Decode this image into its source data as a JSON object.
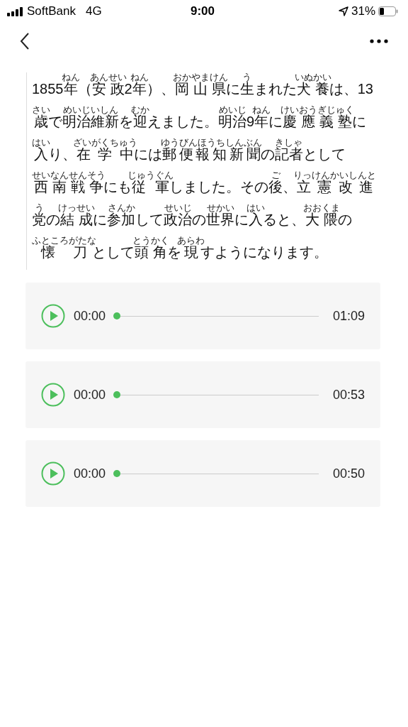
{
  "status_bar": {
    "carrier": "SoftBank",
    "network": "4G",
    "time": "9:00",
    "battery": "31%"
  },
  "paragraph": [
    {
      "t": "1855"
    },
    {
      "t": "年",
      "r": "ねん"
    },
    {
      "t": "（"
    },
    {
      "t": "安政",
      "r": "あんせい"
    },
    {
      "t": "2"
    },
    {
      "t": "年",
      "r": "ねん"
    },
    {
      "t": "）、"
    },
    {
      "t": "岡山県",
      "r": "おかやまけん"
    },
    {
      "t": "に"
    },
    {
      "t": "生",
      "r": "う"
    },
    {
      "t": "まれた"
    },
    {
      "t": "犬養",
      "r": "いぬかい"
    },
    {
      "t": "は、13"
    },
    {
      "t": "歳",
      "r": "さい"
    },
    {
      "t": "で"
    },
    {
      "t": "明治維新",
      "r": "めいじいしん"
    },
    {
      "t": "を"
    },
    {
      "t": "迎",
      "r": "むか"
    },
    {
      "t": "えました。"
    },
    {
      "t": "明治",
      "r": "めいじ"
    },
    {
      "t": "9"
    },
    {
      "t": "年",
      "r": "ねん"
    },
    {
      "t": "に"
    },
    {
      "t": "慶應義塾",
      "r": "けいおうぎじゅく"
    },
    {
      "t": "に"
    },
    {
      "t": "入",
      "r": "はい"
    },
    {
      "t": "り、"
    },
    {
      "t": "在学中",
      "r": "ざいがくちゅう"
    },
    {
      "t": "には"
    },
    {
      "t": "郵便報知新聞",
      "r": "ゆうびんほうちしんぶん"
    },
    {
      "t": "の"
    },
    {
      "t": "記者",
      "r": "きしゃ"
    },
    {
      "t": "として"
    },
    {
      "t": "西南戦争",
      "r": "せいなんせんそう"
    },
    {
      "t": "にも"
    },
    {
      "t": "従軍",
      "r": "じゅうぐん"
    },
    {
      "t": "しました。その"
    },
    {
      "t": "後",
      "r": "ご"
    },
    {
      "t": "、"
    },
    {
      "t": "立憲改進党",
      "r": "りっけんかいしんとう"
    },
    {
      "t": "の"
    },
    {
      "t": "結成",
      "r": "けっせい"
    },
    {
      "t": "に"
    },
    {
      "t": "参加",
      "r": "さんか"
    },
    {
      "t": "して"
    },
    {
      "t": "政治",
      "r": "せいじ"
    },
    {
      "t": "の"
    },
    {
      "t": "世界",
      "r": "せかい"
    },
    {
      "t": "に"
    },
    {
      "t": "入",
      "r": "はい"
    },
    {
      "t": "ると、"
    },
    {
      "t": "大隈",
      "r": "おおくま"
    },
    {
      "t": "の"
    },
    {
      "t": "懐刀",
      "r": "ふところがたな"
    },
    {
      "t": "として"
    },
    {
      "t": "頭角",
      "r": "とうかく"
    },
    {
      "t": "を"
    },
    {
      "t": "現",
      "r": "あらわ"
    },
    {
      "t": "すようになります。"
    }
  ],
  "players": [
    {
      "current": "00:00",
      "duration": "01:09",
      "level": 0
    },
    {
      "current": "00:00",
      "duration": "00:53",
      "level": 0
    },
    {
      "current": "00:00",
      "duration": "00:50",
      "level": 0
    }
  ]
}
